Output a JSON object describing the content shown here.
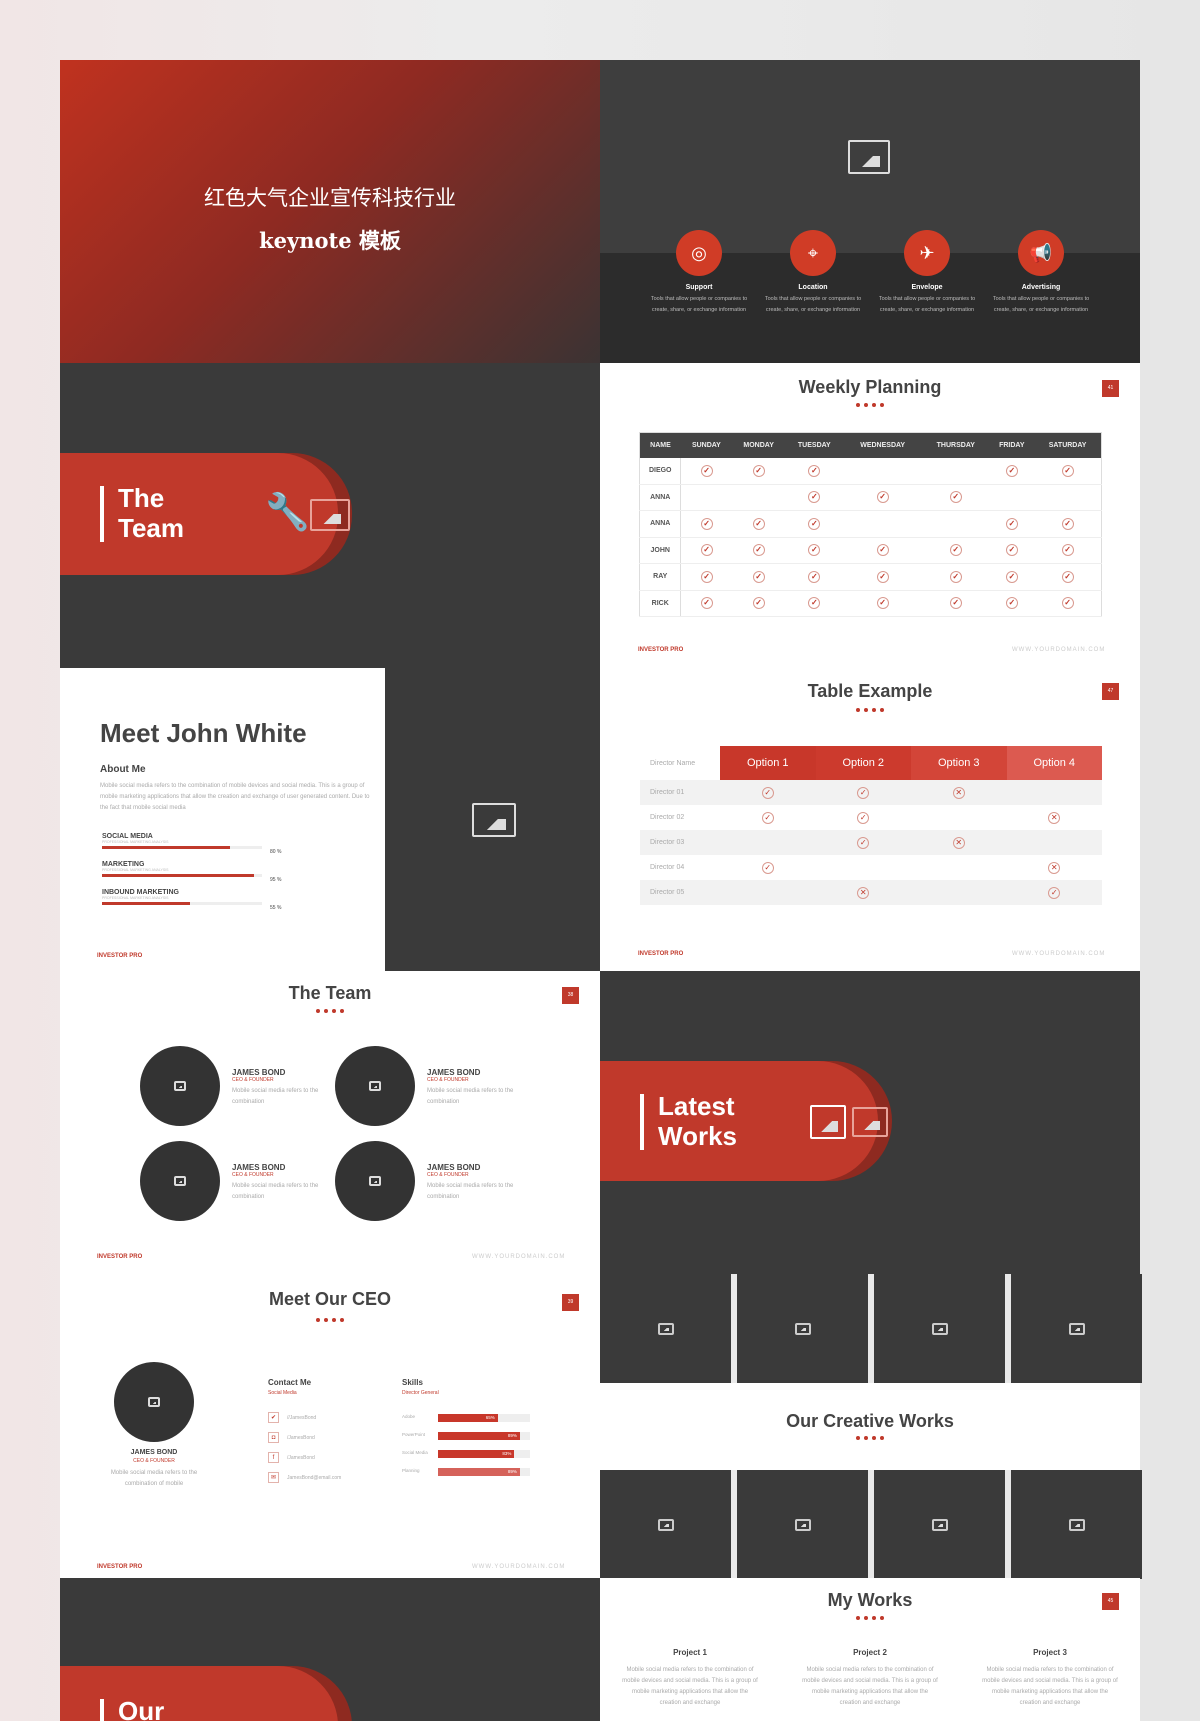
{
  "cover": {
    "title_line1": "红色大气企业宣传科技行业",
    "title_line2": "keynote 模板"
  },
  "features": [
    {
      "icon": "lifebuoy-icon",
      "glyph": "◎",
      "title": "Support",
      "desc": "Tools that allow people or companies to create, share, or exchange information"
    },
    {
      "icon": "location-pin-icon",
      "glyph": "⌖",
      "title": "Location",
      "desc": "Tools that allow people or companies to create, share, or exchange information"
    },
    {
      "icon": "paper-plane-icon",
      "glyph": "✈",
      "title": "Envelope",
      "desc": "Tools that allow people or companies to create, share, or exchange information"
    },
    {
      "icon": "megaphone-icon",
      "glyph": "📢",
      "title": "Advertising",
      "desc": "Tools that allow people or companies to create, share, or exchange information"
    }
  ],
  "team_section": {
    "line1": "The",
    "line2": "Team"
  },
  "john": {
    "title": "Meet John White",
    "about_heading": "About Me",
    "about_text": "Mobile social media refers to the combination of mobile devices and social media. This is a group of mobile marketing applications that allow the creation and exchange of user generated content. Due to the fact that mobile social media",
    "skills": [
      {
        "name": "SOCIAL MEDIA",
        "sub": "PROFESSIONAL MARKETING ANALYSIS",
        "pct": "80 %",
        "value": 80
      },
      {
        "name": "MARKETING",
        "sub": "PROFESSIONAL MARKETING ANALYSIS",
        "pct": "95 %",
        "value": 95
      },
      {
        "name": "INBOUND MARKETING",
        "sub": "PROFESSIONAL MARKETING ANALYSIS",
        "pct": "55 %",
        "value": 55
      }
    ]
  },
  "footer": {
    "brand": "INVESTOR PRO",
    "domain": "WWW.YOURDOMAIN.COM"
  },
  "weekly": {
    "title": "Weekly Planning",
    "page": "41",
    "headers": [
      "NAME",
      "SUNDAY",
      "MONDAY",
      "TUESDAY",
      "WEDNESDAY",
      "THURSDAY",
      "FRIDAY",
      "SATURDAY"
    ],
    "rows": [
      [
        "DIEGO",
        1,
        1,
        1,
        0,
        0,
        1,
        1
      ],
      [
        "ANNA",
        0,
        0,
        1,
        1,
        1,
        0,
        0
      ],
      [
        "ANNA",
        1,
        1,
        1,
        0,
        0,
        1,
        1
      ],
      [
        "JOHN",
        1,
        1,
        1,
        1,
        1,
        1,
        1
      ],
      [
        "RAY",
        1,
        1,
        1,
        1,
        1,
        1,
        1
      ],
      [
        "RICK",
        1,
        1,
        1,
        1,
        1,
        1,
        1
      ]
    ]
  },
  "table_example": {
    "title": "Table Example",
    "page": "47",
    "name_header": "Director Name",
    "options": [
      "Option 1",
      "Option 2",
      "Option 3",
      "Option 4"
    ],
    "option_colors": [
      "#c8372a",
      "#cc3a2d",
      "#d34538",
      "#dc5a50"
    ],
    "rows": [
      [
        "Director 01",
        "yes",
        "yes",
        "no",
        ""
      ],
      [
        "Director 02",
        "yes",
        "yes",
        "",
        "no"
      ],
      [
        "Director 03",
        "",
        "yes",
        "no",
        ""
      ],
      [
        "Director 04",
        "yes",
        "",
        "",
        "no"
      ],
      [
        "Director 05",
        "",
        "no",
        "",
        "yes"
      ]
    ]
  },
  "the_team": {
    "title": "The Team",
    "page": "38",
    "members": [
      {
        "name": "JAMES BOND",
        "role": "CEO & FOUNDER",
        "desc": "Mobile social media refers to the combination"
      },
      {
        "name": "JAMES BOND",
        "role": "CEO & FOUNDER",
        "desc": "Mobile social media refers to the combination"
      },
      {
        "name": "JAMES BOND",
        "role": "CEO & FOUNDER",
        "desc": "Mobile social media refers to the combination"
      },
      {
        "name": "JAMES BOND",
        "role": "CEO & FOUNDER",
        "desc": "Mobile social media refers to the combination"
      }
    ]
  },
  "ceo": {
    "title": "Meet Our CEO",
    "page": "39",
    "name": "JAMES BOND",
    "role": "CEO & FOUNDER",
    "desc": "Mobile social media refers to the combination of mobile",
    "contact_heading": "Contact Me",
    "contact_sub": "Social Media",
    "contacts": [
      {
        "icon": "twitter-icon",
        "glyph": "✔",
        "text": "//JamesBond"
      },
      {
        "icon": "instagram-icon",
        "glyph": "◘",
        "text": "/JamesBond"
      },
      {
        "icon": "facebook-icon",
        "glyph": "f",
        "text": "/JamesBond"
      },
      {
        "icon": "mail-icon",
        "glyph": "✉",
        "text": "JamesBond@email.com"
      }
    ],
    "skills_heading": "Skills",
    "skills_sub": "Director General",
    "skills": [
      {
        "name": "Adobe",
        "pct": "65%",
        "value": 65
      },
      {
        "name": "PowerPoint",
        "pct": "89%",
        "value": 89
      },
      {
        "name": "Social Media",
        "pct": "83%",
        "value": 83
      },
      {
        "name": "Planning",
        "pct": "89%",
        "value": 89
      }
    ]
  },
  "latest": {
    "line1": "Latest",
    "line2": "Works"
  },
  "creative": {
    "title": "Our Creative Works"
  },
  "my_works": {
    "title": "My Works",
    "page": "45",
    "projects": [
      {
        "title": "Project 1",
        "desc": "Mobile social media refers to the combination of mobile devices and social media. This is a group of mobile marketing applications that allow the creation and exchange"
      },
      {
        "title": "Project 2",
        "desc": "Mobile social media refers to the combination of mobile devices and social media. This is a group of mobile marketing applications that allow the creation and exchange"
      },
      {
        "title": "Project 3",
        "desc": "Mobile social media refers to the combination of mobile devices and social media. This is a group of mobile marketing applications that allow the creation and exchange"
      }
    ]
  },
  "our_section": {
    "line1": "Our"
  },
  "colors": {
    "accent": "#c0392b",
    "dark": "#3a3a3a"
  }
}
